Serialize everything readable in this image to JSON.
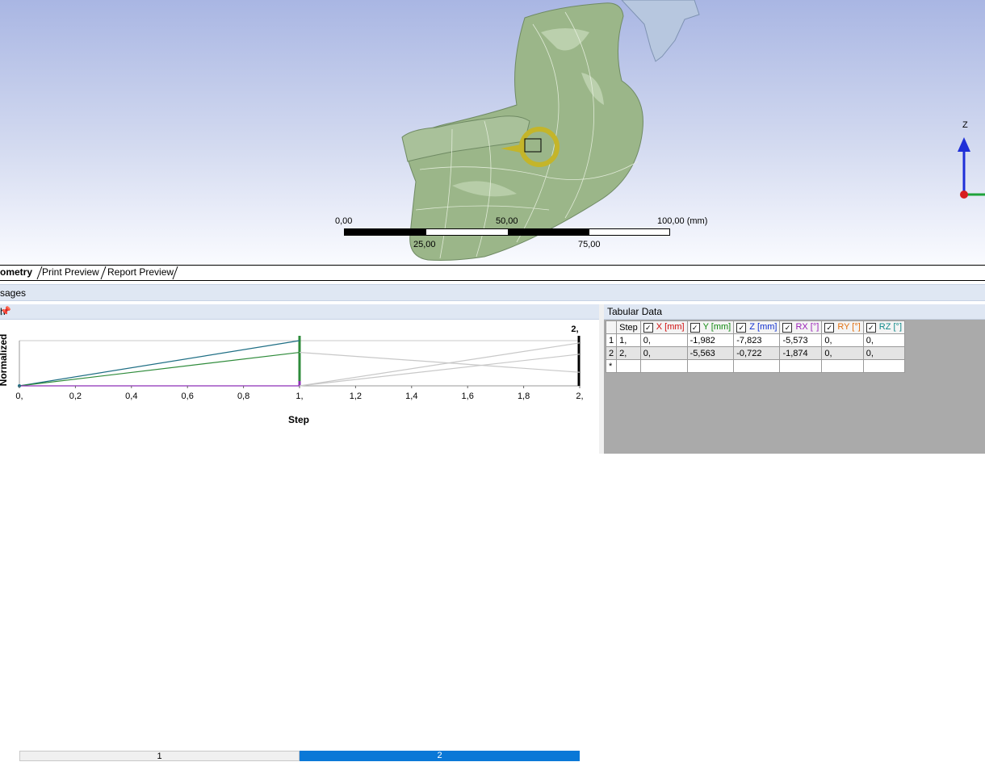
{
  "viewport": {
    "axis_label": "Z",
    "scale": {
      "labels_top": [
        "0,00",
        "50,00",
        "100,00 (mm)"
      ],
      "labels_bottom": [
        "25,00",
        "75,00"
      ]
    },
    "colors": {
      "model": "#9bb689",
      "load_arrow": "#c4b52a",
      "axis_z": "#1f2fd8",
      "axis_y": "#1fa33a",
      "axis_x": "#d81f1f"
    }
  },
  "tabs": [
    {
      "label": "ometry",
      "active": true
    },
    {
      "label": "Print Preview",
      "active": false
    },
    {
      "label": "Report Preview",
      "active": false
    }
  ],
  "messages": {
    "label": "sages"
  },
  "graph_panel": {
    "title": "h",
    "ylabel": "Normalized",
    "xlabel": "Step",
    "top_label": "2,",
    "steps": [
      "1",
      "2"
    ]
  },
  "chart_data": {
    "type": "line",
    "xlabel": "Step",
    "ylabel": "Normalized",
    "ticks": [
      "0,",
      "0,2",
      "0,4",
      "0,6",
      "0,8",
      "1,",
      "1,2",
      "1,4",
      "1,6",
      "1,8",
      "2,"
    ],
    "xlim": [
      0,
      2
    ],
    "series": [
      {
        "x": [
          0,
          1
        ],
        "y": [
          0,
          1.0
        ],
        "color": "#1e6e84"
      },
      {
        "x": [
          0,
          1
        ],
        "y": [
          0,
          0.74
        ],
        "color": "#2e8b3a"
      },
      {
        "x": [
          0,
          1
        ],
        "y": [
          0,
          0
        ],
        "color": "#8e2fb6"
      },
      {
        "x": [
          1,
          2
        ],
        "y": [
          0.74,
          0.3
        ],
        "color": "#c8c8c8"
      },
      {
        "x": [
          1,
          2
        ],
        "y": [
          0,
          0.7
        ],
        "color": "#c8c8c8"
      },
      {
        "x": [
          1,
          2
        ],
        "y": [
          0,
          0.95
        ],
        "color": "#c8c8c8"
      }
    ]
  },
  "tabular": {
    "title": "Tabular Data",
    "columns": [
      {
        "label": "Step",
        "checkbox": false,
        "color": "#000000"
      },
      {
        "label": "X [mm]",
        "checkbox": true,
        "color": "#d01010"
      },
      {
        "label": "Y [mm]",
        "checkbox": true,
        "color": "#128a12"
      },
      {
        "label": "Z [mm]",
        "checkbox": true,
        "color": "#1030d0"
      },
      {
        "label": "RX [°]",
        "checkbox": true,
        "color": "#9a20b8"
      },
      {
        "label": "RY [°]",
        "checkbox": true,
        "color": "#e07010"
      },
      {
        "label": "RZ [°]",
        "checkbox": true,
        "color": "#108a8a"
      }
    ],
    "rows": [
      {
        "index": "1",
        "cells": [
          "1,",
          "0,",
          "-1,982",
          "-7,823",
          "-5,573",
          "0,",
          "0,"
        ]
      },
      {
        "index": "2",
        "cells": [
          "2,",
          "0,",
          "-5,563",
          "-0,722",
          "-1,874",
          "0,",
          "0,"
        ]
      }
    ],
    "new_row_marker": "*",
    "check_mark": "✓"
  }
}
